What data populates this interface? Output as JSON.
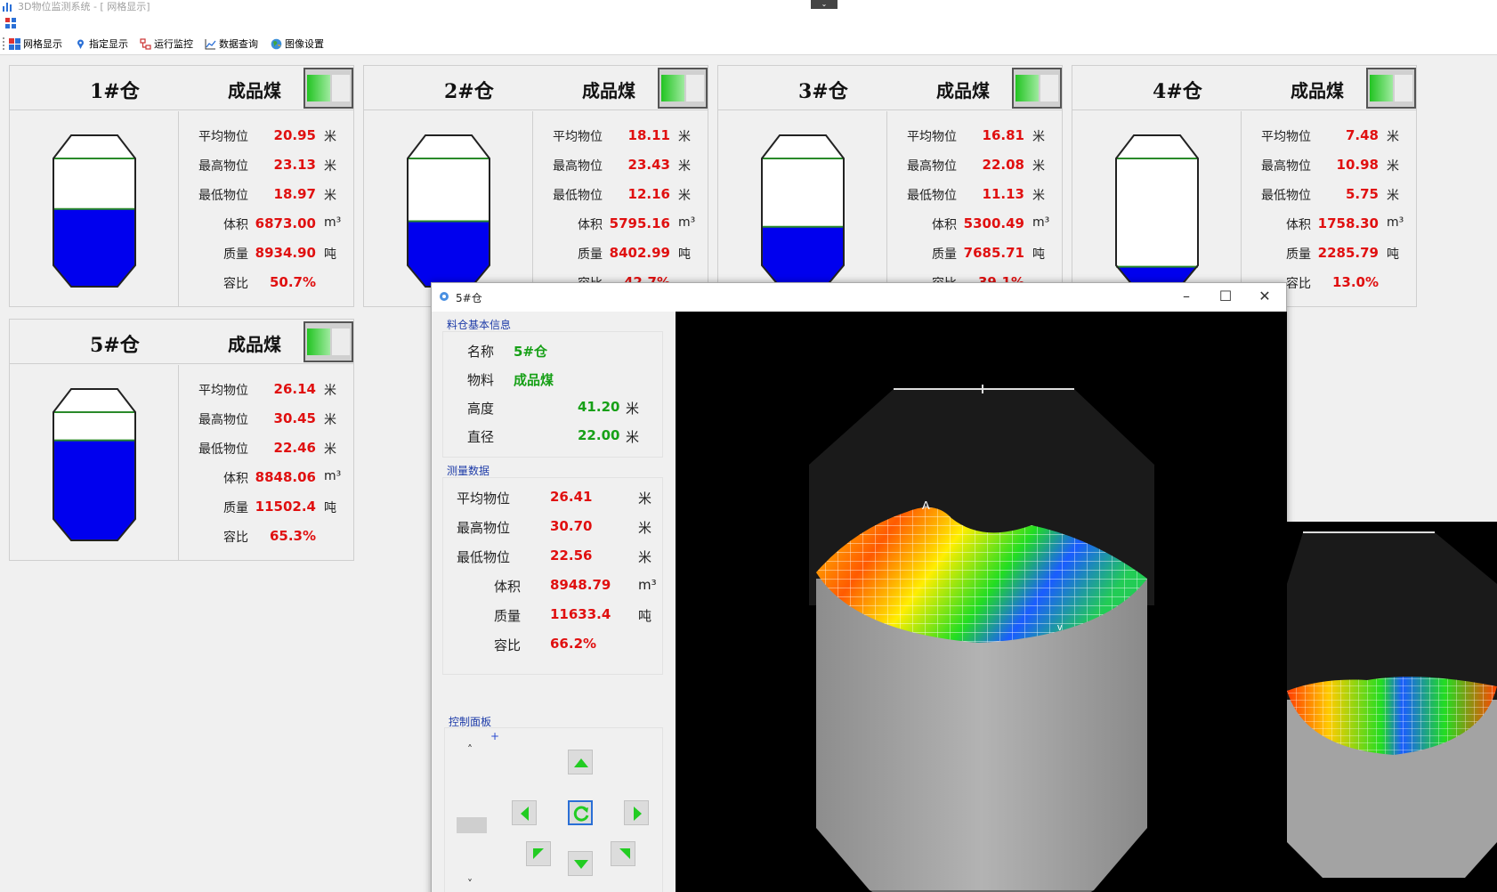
{
  "window": {
    "title": "3D物位监测系统 - [ 网格显示]"
  },
  "toolbar": {
    "items": [
      {
        "label": "网格显示",
        "icon": "grid-icon"
      },
      {
        "label": "指定显示",
        "icon": "location-pin-icon"
      },
      {
        "label": "运行监控",
        "icon": "network-icon"
      },
      {
        "label": "数据查询",
        "icon": "line-chart-icon"
      },
      {
        "label": "图像设置",
        "icon": "globe-icon"
      }
    ]
  },
  "labels": {
    "avg": "平均物位",
    "max": "最高物位",
    "min": "最低物位",
    "volume": "体积",
    "mass": "质量",
    "ratio": "容比",
    "unit_m": "米",
    "unit_m3": "m³",
    "unit_t": "吨"
  },
  "colors": {
    "fill": "#0000ee",
    "value": "#e01010",
    "accent_green": "#17a017"
  },
  "silos": [
    {
      "name": "1#仓",
      "material": "成品煤",
      "avg": "20.95",
      "max": "23.13",
      "min": "18.97",
      "volume": "6873.00",
      "mass": "8934.90",
      "ratio": "50.7%",
      "fill_fraction": 0.507
    },
    {
      "name": "2#仓",
      "material": "成品煤",
      "avg": "18.11",
      "max": "23.43",
      "min": "12.16",
      "volume": "5795.16",
      "mass": "8402.99",
      "ratio": "42.7%",
      "fill_fraction": 0.427
    },
    {
      "name": "3#仓",
      "material": "成品煤",
      "avg": "16.81",
      "max": "22.08",
      "min": "11.13",
      "volume": "5300.49",
      "mass": "7685.71",
      "ratio": "39.1%",
      "fill_fraction": 0.391
    },
    {
      "name": "4#仓",
      "material": "成品煤",
      "avg": "7.48",
      "max": "10.98",
      "min": "5.75",
      "volume": "1758.30",
      "mass": "2285.79",
      "ratio": "13.0%",
      "fill_fraction": 0.13
    },
    {
      "name": "5#仓",
      "material": "成品煤",
      "avg": "26.14",
      "max": "30.45",
      "min": "22.46",
      "volume": "8848.06",
      "mass": "11502.4",
      "ratio": "65.3%",
      "fill_fraction": 0.653
    }
  ],
  "detail": {
    "title": "5#仓",
    "basic_group": "料仓基本信息",
    "name_label": "名称",
    "name_value": "5#仓",
    "material_label": "物料",
    "material_value": "成品煤",
    "height_label": "高度",
    "height_value": "41.20",
    "diameter_label": "直径",
    "diameter_value": "22.00",
    "measure_group": "测量数据",
    "avg": "26.41",
    "max": "30.70",
    "min": "22.56",
    "volume": "8948.79",
    "mass": "11633.4",
    "ratio": "66.2%",
    "control_group": "控制面板",
    "zoom_in": "+",
    "zoom_out": "-",
    "peak_marker": "A",
    "minimize": "–",
    "maximize": "☐",
    "close": "✕"
  }
}
